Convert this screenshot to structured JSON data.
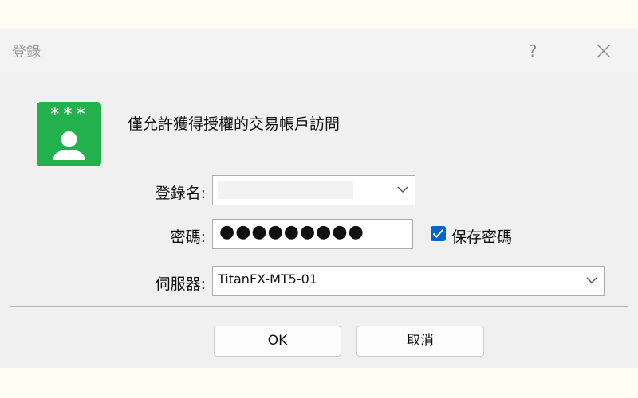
{
  "dialog": {
    "title": "登錄",
    "help_label": "?",
    "message": "僅允許獲得授權的交易帳戶訪問",
    "icon": "account-key-icon",
    "logo_stars": "***"
  },
  "form": {
    "login": {
      "label": "登錄名:",
      "value": ""
    },
    "password": {
      "label": "密碼:",
      "value": "●●●●●●●●●"
    },
    "save_password": {
      "label": "保存密碼",
      "checked": true
    },
    "server": {
      "label": "伺服器:",
      "value": "TitanFX-MT5-01"
    }
  },
  "buttons": {
    "ok": "OK",
    "cancel": "取消"
  },
  "colors": {
    "logo_green": "#22b14c",
    "checkbox_blue": "#0a64c8"
  }
}
